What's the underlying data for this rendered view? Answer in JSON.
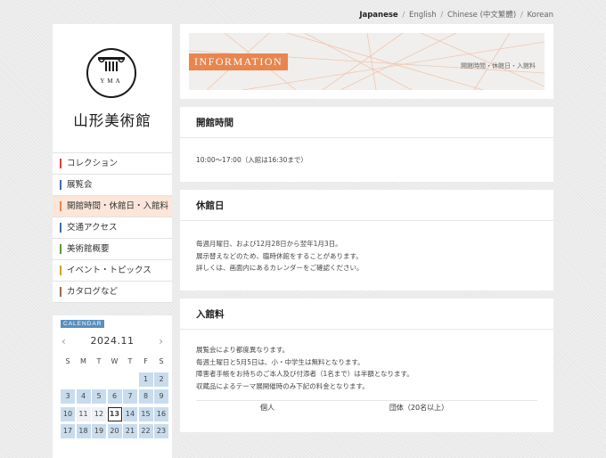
{
  "languages": {
    "current": "Japanese",
    "items": [
      "English",
      "Chinese (中文繁體)",
      "Korean"
    ],
    "separator": "/"
  },
  "logo": {
    "mark": "YMA",
    "name": "山形美術館"
  },
  "nav": {
    "items": [
      {
        "label": "コレクション",
        "color": "#d9453b"
      },
      {
        "label": "展覧会",
        "color": "#3d6fa8"
      },
      {
        "label": "開館時間・休館日・入館料",
        "color": "#e8864e",
        "active": true
      },
      {
        "label": "交通アクセス",
        "color": "#3d6fa8"
      },
      {
        "label": "美術館概要",
        "color": "#5b9b3a"
      },
      {
        "label": "イベント・トピックス",
        "color": "#d4a02c"
      },
      {
        "label": "カタログなど",
        "color": "#9a6c4c"
      }
    ]
  },
  "calendar": {
    "badge": "CALENDAR",
    "title": "2024.11",
    "prev": "‹",
    "next": "›",
    "dow": [
      "S",
      "M",
      "T",
      "W",
      "T",
      "F",
      "S"
    ],
    "rows": [
      [
        "",
        "",
        "",
        "",
        "",
        "1",
        "2"
      ],
      [
        "3",
        "4",
        "5",
        "6",
        "7",
        "8",
        "9"
      ],
      [
        "10",
        "11",
        "12",
        "13",
        "14",
        "15",
        "16"
      ],
      [
        "17",
        "18",
        "19",
        "20",
        "21",
        "22",
        "23"
      ]
    ],
    "today": "13",
    "open_days": [
      "11",
      "12"
    ]
  },
  "banner": {
    "tag": "INFORMATION",
    "breadcrumb": "開館時間・休館日・入館料"
  },
  "hours": {
    "title": "開館時間",
    "text": "10:00～17:00（入館は16:30まで）"
  },
  "closed": {
    "title": "休館日",
    "lines": [
      "毎週月曜日、および12月28日から翌年1月3日。",
      "展示替えなどのため、臨時休館をすることがあります。",
      "詳しくは、画面内にあるカレンダーをご確認ください。"
    ]
  },
  "admission": {
    "title": "入館料",
    "lines": [
      "展覧会により都度異なります。",
      "毎週土曜日と5月5日は、小・中学生は無料となります。",
      "障害者手帳をお持ちのご本人及び付添者（1名まで）は半額となります。",
      "収蔵品によるテーマ展開催時のみ下記の料金となります。"
    ],
    "table_headers": [
      "個人",
      "団体（20名以上）"
    ]
  },
  "colors": {
    "accent": "#e8864e",
    "calendar": "#5a8fbd"
  }
}
